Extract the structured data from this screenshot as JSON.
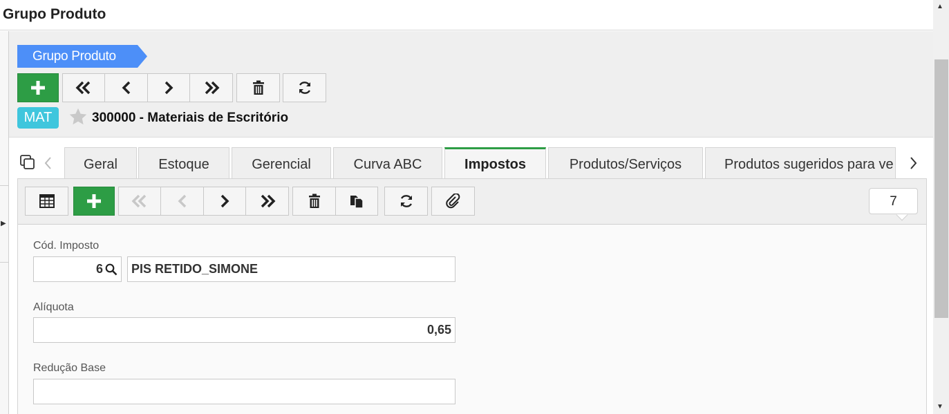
{
  "window": {
    "title": "Grupo Produto"
  },
  "breadcrumb": {
    "label": "Grupo Produto"
  },
  "record": {
    "badge": "MAT",
    "title": "300000 - Materiais de Escritório"
  },
  "tabs": [
    {
      "label": "Geral",
      "active": false
    },
    {
      "label": "Estoque",
      "active": false
    },
    {
      "label": "Gerencial",
      "active": false
    },
    {
      "label": "Curva ABC",
      "active": false
    },
    {
      "label": "Impostos",
      "active": true
    },
    {
      "label": "Produtos/Serviços",
      "active": false
    },
    {
      "label": "Produtos sugeridos para ve",
      "active": false
    }
  ],
  "record_counter": "7",
  "form": {
    "cod_imposto": {
      "label": "Cód. Imposto",
      "value": "6",
      "description": "PIS RETIDO_SIMONE"
    },
    "aliquota": {
      "label": "Alíquota",
      "value": "0,65"
    },
    "reducao_base": {
      "label": "Redução Base",
      "value": ""
    }
  },
  "colors": {
    "accent_green": "#2d9d45",
    "breadcrumb_blue": "#4d8ff8",
    "badge_cyan": "#3fc6dd"
  }
}
